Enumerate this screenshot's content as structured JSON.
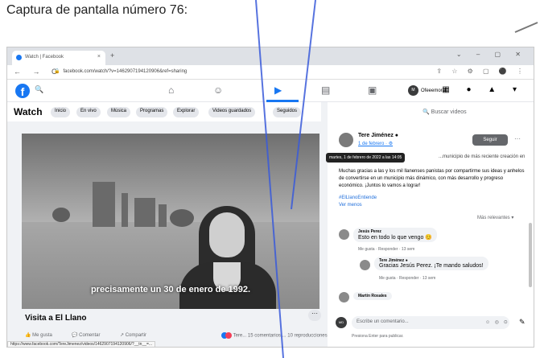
{
  "doc_title": "Captura de pantalla número 76:",
  "browser": {
    "tab_title": "Watch | Facebook",
    "tab_close": "×",
    "new_tab": "+",
    "window_controls": "⌄ – ▢ ✕",
    "nav": "← → C",
    "url": "facebook.com/watch/?v=1462907194120906&ref=sharing",
    "addr_icons": "⇪ ☆ ⚙ ▢ ⚫ ⋮"
  },
  "fb_header": {
    "logo": "f",
    "search_glyph": "🔍",
    "profile_chip_avatar": "M",
    "profile_name": "Ofeeemoral",
    "right_icons": "▦ ● ▲ ▾"
  },
  "watch": {
    "title": "Watch",
    "tabs": [
      "Inicio",
      "En vivo",
      "Música",
      "Programas",
      "Explorar",
      "Videos guardados",
      "Seguidos"
    ]
  },
  "video": {
    "subtitle": "precisamente un 30 de enero de 1992.",
    "title": "Visita a El Llano",
    "more": "···",
    "actions": {
      "like": "Me gusta",
      "comment": "Comentar",
      "share": "Compartir",
      "reactions_text": "Tere... 15 comentarios ... 10 reproducciones"
    },
    "status_url": "https://www.facebook.com/TereJimenez/videos/1462907194120906/?__tn__=..."
  },
  "right": {
    "search_placeholder": "Buscar videos",
    "post": {
      "author": "Tere Jiménez ●",
      "date": "1 de febrero · ⚙",
      "follow": "Seguir",
      "more": "···",
      "tooltip": "martes, 1 de febrero de 2022 a las 14:05",
      "text_fragment": "...municipio de más reciente creación en",
      "body": "Muchas gracias a las y los mil llanenses panistas por compartirme sus ideas y anhelos de convertirse en un municipio más dinámico, con más desarrollo y progreso económico. ¡Juntos lo vamos a lograr!",
      "hashtag": "#ElLlanoEntiende",
      "see_less": "Ver menos"
    },
    "sort_label": "Más relevantes ▾",
    "comments": [
      {
        "name": "Jesús Perez",
        "text": "Esto en todo lo que vengo 😊",
        "meta": "Me gusta · Responder · 13 sem"
      },
      {
        "name": "Tere Jiménez ●",
        "text": "Gracias Jesús Perez. ¡Te mando saludos!",
        "meta": "Me gusta · Responder · 13 sem"
      },
      {
        "name": "Martín Rosales",
        "text": "",
        "meta": ""
      }
    ],
    "composer": {
      "avatar": "MD",
      "placeholder": "Escribe un comentario...",
      "emojis": "☺ ◎ ⊙",
      "edit_icon": "✎",
      "hint": "Presiona Enter para publicar."
    }
  }
}
